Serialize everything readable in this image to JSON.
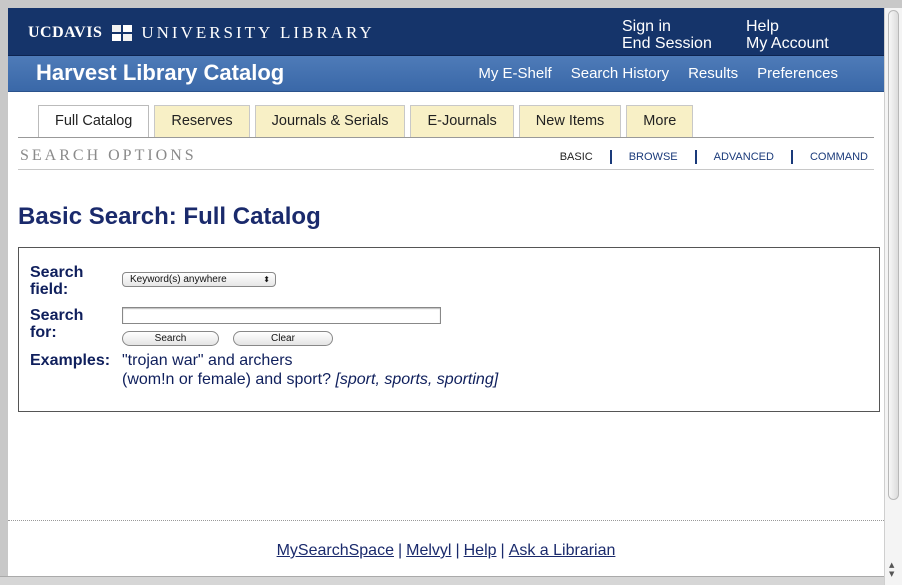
{
  "header": {
    "logo_uc": "UC",
    "logo_davis": "DAVIS",
    "logo_library": "UNIVERSITY LIBRARY",
    "sign_in": "Sign in",
    "end_session": "End Session",
    "help": "Help",
    "my_account": "My Account"
  },
  "navbar": {
    "title": "Harvest Library Catalog",
    "links": [
      "My E-Shelf",
      "Search History",
      "Results",
      "Preferences"
    ]
  },
  "tabs": [
    "Full Catalog",
    "Reserves",
    "Journals & Serials",
    "E-Journals",
    "New Items",
    "More"
  ],
  "active_tab": "Full Catalog",
  "search_options": {
    "title": "SEARCH OPTIONS",
    "links": [
      "BASIC",
      "BROWSE",
      "ADVANCED",
      "COMMAND"
    ]
  },
  "page_title": "Basic Search: Full Catalog",
  "form": {
    "field_label_1": "Search",
    "field_label_2": "field:",
    "field_value": "Keyword(s) anywhere",
    "for_label_1": "Search",
    "for_label_2": "for:",
    "search_value": "",
    "search_button": "Search",
    "clear_button": "Clear",
    "examples_label": "Examples:",
    "example_1": "\"trojan war\" and archers",
    "example_2": "(wom!n or female) and sport?",
    "example_2_hint": "[sport, sports, sporting]"
  },
  "footer": {
    "links": [
      "MySearchSpace",
      "Melvyl",
      "Help",
      "Ask a Librarian"
    ],
    "separator": "|"
  }
}
